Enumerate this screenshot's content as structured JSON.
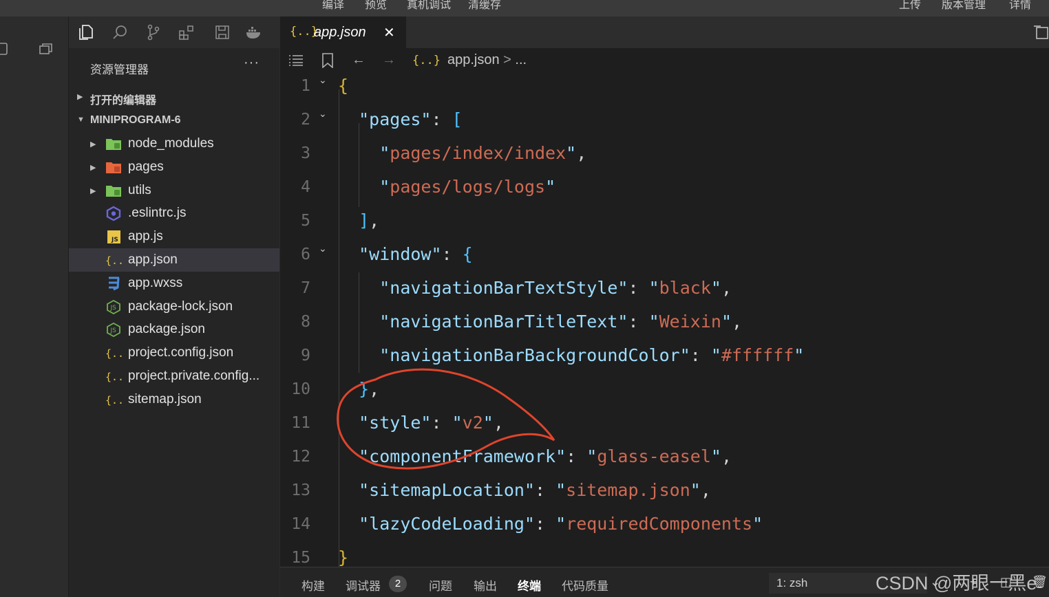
{
  "toolbar": {
    "compile": "编译",
    "preview": "预览",
    "remote_debug": "真机调试",
    "clear_cache": "清缓存",
    "upload": "上传",
    "version_mgmt": "版本管理",
    "details": "详情"
  },
  "sidebar": {
    "title": "资源管理器",
    "more": "···",
    "open_editors": "打开的编辑器",
    "project": "MINIPROGRAM-6",
    "files": [
      {
        "name": "node_modules",
        "type": "folder",
        "icon": "folder-green-icon"
      },
      {
        "name": "pages",
        "type": "folder",
        "icon": "folder-orange-icon"
      },
      {
        "name": "utils",
        "type": "folder",
        "icon": "folder-green-icon"
      },
      {
        "name": ".eslintrc.js",
        "type": "file",
        "icon": "eslint-icon"
      },
      {
        "name": "app.js",
        "type": "file",
        "icon": "js-icon"
      },
      {
        "name": "app.json",
        "type": "file",
        "icon": "json-icon",
        "selected": true
      },
      {
        "name": "app.wxss",
        "type": "file",
        "icon": "css-icon"
      },
      {
        "name": "package-lock.json",
        "type": "file",
        "icon": "node-icon"
      },
      {
        "name": "package.json",
        "type": "file",
        "icon": "node-icon"
      },
      {
        "name": "project.config.json",
        "type": "file",
        "icon": "json-icon"
      },
      {
        "name": "project.private.config...",
        "type": "file",
        "icon": "json-icon"
      },
      {
        "name": "sitemap.json",
        "type": "file",
        "icon": "json-icon"
      }
    ]
  },
  "editor": {
    "tab_icon": "{..}",
    "tab_label": "app.json",
    "tab_close": "✕",
    "breadcrumb_file": "app.json",
    "breadcrumb_sep": ">",
    "breadcrumb_more": "...",
    "lines": [
      {
        "n": "1",
        "parts": [
          [
            "bro",
            "{"
          ]
        ]
      },
      {
        "n": "2",
        "parts": [
          [
            "p",
            "  "
          ],
          [
            "k",
            "\"pages\""
          ],
          [
            "p",
            ": "
          ],
          [
            "br",
            "["
          ]
        ]
      },
      {
        "n": "3",
        "parts": [
          [
            "p",
            "    "
          ],
          [
            "k",
            "\""
          ],
          [
            "s",
            "pages/index/index"
          ],
          [
            "k",
            "\""
          ],
          [
            "p",
            ","
          ]
        ]
      },
      {
        "n": "4",
        "parts": [
          [
            "p",
            "    "
          ],
          [
            "k",
            "\""
          ],
          [
            "s",
            "pages/logs/logs"
          ],
          [
            "k",
            "\""
          ]
        ]
      },
      {
        "n": "5",
        "parts": [
          [
            "p",
            "  "
          ],
          [
            "br",
            "]"
          ],
          [
            "p",
            ","
          ]
        ]
      },
      {
        "n": "6",
        "parts": [
          [
            "p",
            "  "
          ],
          [
            "k",
            "\"window\""
          ],
          [
            "p",
            ": "
          ],
          [
            "br",
            "{"
          ]
        ]
      },
      {
        "n": "7",
        "parts": [
          [
            "p",
            "    "
          ],
          [
            "k",
            "\"navigationBarTextStyle\""
          ],
          [
            "p",
            ": "
          ],
          [
            "k",
            "\""
          ],
          [
            "s",
            "black"
          ],
          [
            "k",
            "\""
          ],
          [
            "p",
            ","
          ]
        ]
      },
      {
        "n": "8",
        "parts": [
          [
            "p",
            "    "
          ],
          [
            "k",
            "\"navigationBarTitleText\""
          ],
          [
            "p",
            ": "
          ],
          [
            "k",
            "\""
          ],
          [
            "s",
            "Weixin"
          ],
          [
            "k",
            "\""
          ],
          [
            "p",
            ","
          ]
        ]
      },
      {
        "n": "9",
        "parts": [
          [
            "p",
            "    "
          ],
          [
            "k",
            "\"navigationBarBackgroundColor\""
          ],
          [
            "p",
            ": "
          ],
          [
            "k",
            "\""
          ],
          [
            "s",
            "#ffffff"
          ],
          [
            "k",
            "\""
          ]
        ]
      },
      {
        "n": "10",
        "parts": [
          [
            "p",
            "  "
          ],
          [
            "br",
            "}"
          ],
          [
            "p",
            ","
          ]
        ]
      },
      {
        "n": "11",
        "parts": [
          [
            "p",
            "  "
          ],
          [
            "k",
            "\"style\""
          ],
          [
            "p",
            ": "
          ],
          [
            "k",
            "\""
          ],
          [
            "s",
            "v2"
          ],
          [
            "k",
            "\""
          ],
          [
            "p",
            ","
          ]
        ]
      },
      {
        "n": "12",
        "parts": [
          [
            "p",
            "  "
          ],
          [
            "k",
            "\"componentFramework\""
          ],
          [
            "p",
            ": "
          ],
          [
            "k",
            "\""
          ],
          [
            "s",
            "glass-easel"
          ],
          [
            "k",
            "\""
          ],
          [
            "p",
            ","
          ]
        ]
      },
      {
        "n": "13",
        "parts": [
          [
            "p",
            "  "
          ],
          [
            "k",
            "\"sitemapLocation\""
          ],
          [
            "p",
            ": "
          ],
          [
            "k",
            "\""
          ],
          [
            "s",
            "sitemap.json"
          ],
          [
            "k",
            "\""
          ],
          [
            "p",
            ","
          ]
        ]
      },
      {
        "n": "14",
        "parts": [
          [
            "p",
            "  "
          ],
          [
            "k",
            "\"lazyCodeLoading\""
          ],
          [
            "p",
            ": "
          ],
          [
            "k",
            "\""
          ],
          [
            "s",
            "requiredComponents"
          ],
          [
            "k",
            "\""
          ]
        ]
      },
      {
        "n": "15",
        "parts": [
          [
            "bro",
            "}"
          ]
        ]
      }
    ]
  },
  "panel": {
    "tabs": [
      "构建",
      "调试器",
      "问题",
      "输出",
      "终端",
      "代码质量"
    ],
    "active_tab": "终端",
    "debugger_badge": "2",
    "terminal": "1: zsh"
  },
  "watermark": "CSDN @两眼一黑e",
  "colors": {
    "editor_bg": "#1e1e1e",
    "sidebar_bg": "#252526",
    "key": "#9cdcfe",
    "string": "#ce6b55",
    "annotation_red": "#e0442c"
  }
}
